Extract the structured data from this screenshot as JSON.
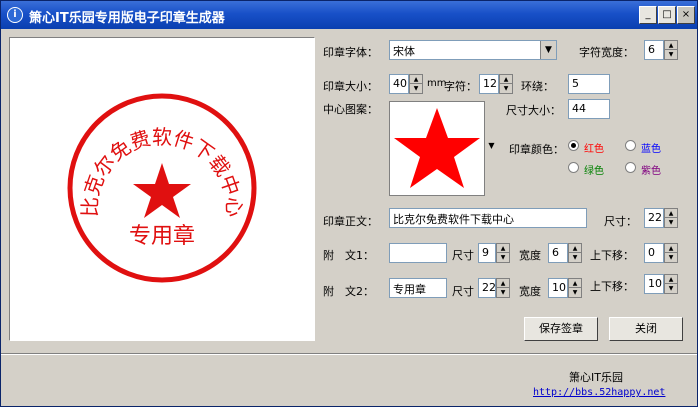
{
  "window": {
    "title": "箫心IT乐园专用版电子印章生成器",
    "min_glyph": "_",
    "max_glyph": "□",
    "close_glyph": "×"
  },
  "stamp": {
    "main_text": "比克尔免费软件下载中心",
    "sub_text": "专用章",
    "color": "#ff0000"
  },
  "form": {
    "font_label": "印章字体：",
    "font_value": "宋体",
    "char_width_label": "字符宽度：",
    "char_width_value": "6",
    "size_label": "印章大小：",
    "size_value": "40",
    "size_unit": "mm",
    "char_label": "字符：",
    "char_value": "12",
    "ring_label": "环绕：",
    "ring_value": "5",
    "pattern_label": "中心图案：",
    "pattern_size_label": "尺寸大小：",
    "pattern_size_value": "44",
    "color_label": "印章颜色：",
    "colors": [
      {
        "label": "红色",
        "color": "#ff0000",
        "selected": true
      },
      {
        "label": "蓝色",
        "color": "#0000ff",
        "selected": false
      },
      {
        "label": "绿色",
        "color": "#008000",
        "selected": false
      },
      {
        "label": "紫色",
        "color": "#800080",
        "selected": false
      }
    ],
    "main_text_label": "印章正文：",
    "main_text_value": "比克尔免费软件下载中心",
    "main_size_label": "尺寸：",
    "main_size_value": "22",
    "sub1_label": "附　文1：",
    "sub1_value": "",
    "sub1_size_label": "尺寸",
    "sub1_size_value": "9",
    "sub1_width_label": "宽度",
    "sub1_width_value": "6",
    "sub1_offset_label": "上下移：",
    "sub1_offset_value": "0",
    "sub2_label": "附　文2：",
    "sub2_value": "专用章",
    "sub2_size_label": "尺寸",
    "sub2_size_value": "22",
    "sub2_width_label": "宽度",
    "sub2_width_value": "10",
    "sub2_offset_label": "上下移：",
    "sub2_offset_value": "10"
  },
  "buttons": {
    "save": "保存签章",
    "close": "关闭"
  },
  "footer": {
    "name": "箫心IT乐园",
    "link": "http://bbs.52happy.net"
  }
}
